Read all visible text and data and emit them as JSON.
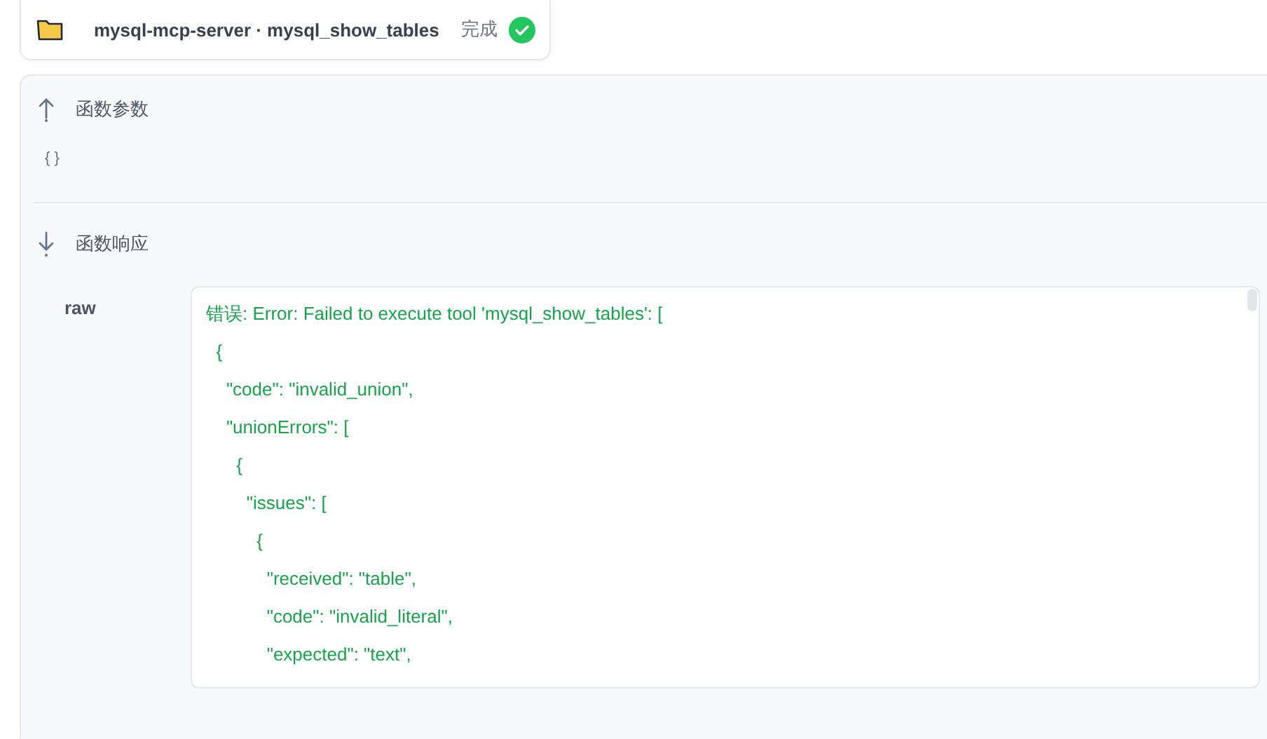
{
  "tool_card": {
    "title": "mysql-mcp-server · mysql_show_tables",
    "status": "完成"
  },
  "sections": [
    {
      "kind": "params",
      "title": "函数参数",
      "body": "{ }"
    },
    {
      "kind": "response",
      "title": "函数响应",
      "label": "raw",
      "lines": [
        "错误: Error: Failed to execute tool 'mysql_show_tables': [",
        "  {",
        "    \"code\": \"invalid_union\",",
        "    \"unionErrors\": [",
        "      {",
        "        \"issues\": [",
        "          {",
        "            \"received\": \"table\",",
        "            \"code\": \"invalid_literal\",",
        "            \"expected\": \"text\","
      ]
    }
  ]
}
